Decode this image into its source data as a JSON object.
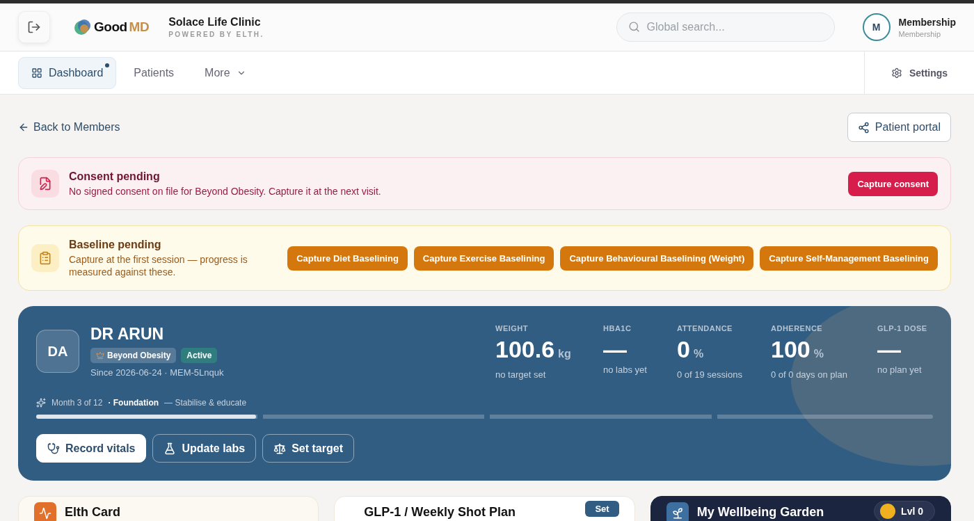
{
  "header": {
    "logo": {
      "good": "Good",
      "md": "MD"
    },
    "clinic": "Solace Life Clinic",
    "powered_by": "POWERED BY ELTH.",
    "search": {
      "placeholder": "Global search..."
    },
    "user": {
      "initial": "M",
      "name": "Membership",
      "role": "Membership"
    }
  },
  "nav": {
    "tabs": [
      {
        "label": "Dashboard",
        "selected": true,
        "kind": "icon",
        "dot": true
      },
      {
        "label": "Patients",
        "selected": false,
        "kind": "plain",
        "dot": false
      },
      {
        "label": "More",
        "selected": false,
        "kind": "menu",
        "dot": false
      }
    ],
    "settings": "Settings"
  },
  "back_link": "Back to Members",
  "portal_button": "Patient portal",
  "consent_alert": {
    "title": "Consent pending",
    "message": "No signed consent on file for Beyond Obesity. Capture it at the next visit.",
    "button": "Capture consent"
  },
  "baseline_alert": {
    "title": "Baseline pending",
    "message": "Capture at the first session — progress is measured against these.",
    "buttons": [
      "Capture Diet Baselining",
      "Capture Exercise Baselining",
      "Capture Behavioural Baselining (Weight)",
      "Capture Self-Management Baselining"
    ]
  },
  "patient": {
    "initials": "DA",
    "name": "DR ARUN",
    "program": "Beyond Obesity",
    "status": "Active",
    "meta": "Since 2026-06-24 · MEM-5Lnquk",
    "stats": [
      {
        "label": "WEIGHT",
        "value": "100.6",
        "unit": "kg",
        "note": "no target set"
      },
      {
        "label": "HBA1C",
        "value": "—",
        "note": "no labs yet"
      },
      {
        "label": "ATTENDANCE",
        "value": "0",
        "unit": "%",
        "note": "0 of 19 sessions"
      },
      {
        "label": "ADHERENCE",
        "value": "100",
        "unit": "%",
        "note": "0 of 0 days on plan"
      },
      {
        "label": "GLP-1 DOSE",
        "value": "—",
        "note": "no plan yet"
      }
    ],
    "phase": {
      "month": "Month 3 of 12",
      "name": "· Foundation",
      "goal": "— Stabilise & educate"
    },
    "phase_progress": {
      "level": 0.25
    },
    "actions": [
      {
        "label": "Record vitals",
        "kind": "vitals",
        "selected": true
      },
      {
        "label": "Update labs",
        "kind": "labs",
        "selected": false
      },
      {
        "label": "Set target",
        "kind": "target",
        "selected": false
      }
    ]
  },
  "cards": [
    {
      "kind": "elth",
      "title": "Elth Card"
    },
    {
      "kind": "plan",
      "title": "GLP-1 / Weekly Shot Plan",
      "button": "Set"
    },
    {
      "kind": "garden",
      "title": "My Wellbeing Garden",
      "badge": "Lvl 0"
    }
  ]
}
